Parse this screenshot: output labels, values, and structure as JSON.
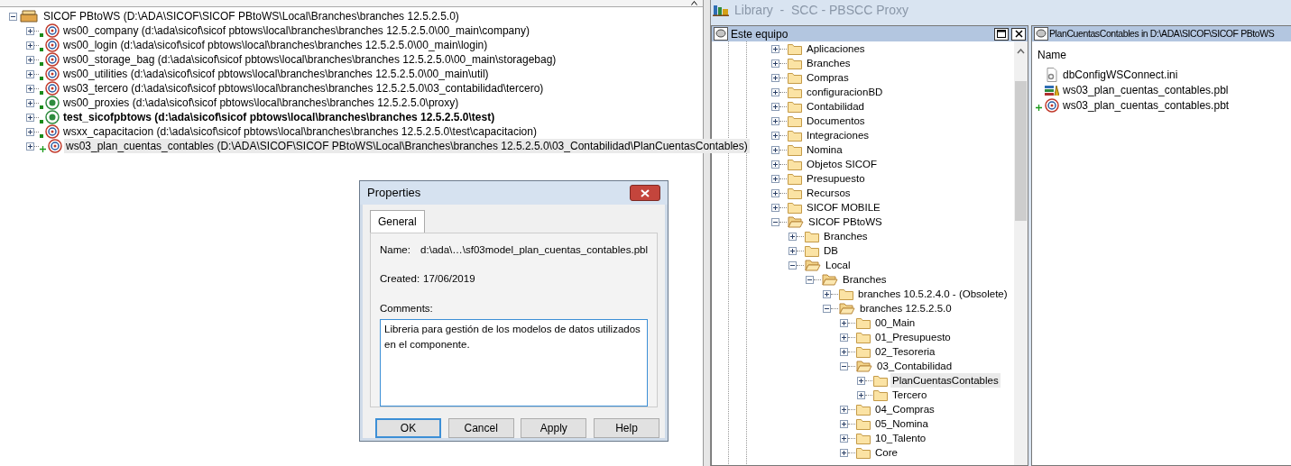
{
  "workspace_tree": {
    "root": {
      "label": "SICOF PBtoWS (D:\\ADA\\SICOF\\SICOF PBtoWS\\Local\\Branches\\branches 12.5.2.5.0)",
      "expanded": true
    },
    "targets": [
      {
        "label": "ws00_company (d:\\ada\\sicof\\sicof pbtows\\local\\branches\\branches 12.5.2.5.0\\00_main\\company)",
        "kind": "web",
        "current": false,
        "added": false,
        "selected": false,
        "expanded": false
      },
      {
        "label": "ws00_login (d:\\ada\\sicof\\sicof pbtows\\local\\branches\\branches 12.5.2.5.0\\00_main\\login)",
        "kind": "web",
        "current": false,
        "added": false,
        "selected": false,
        "expanded": false
      },
      {
        "label": "ws00_storage_bag (d:\\ada\\sicof\\sicof pbtows\\local\\branches\\branches 12.5.2.5.0\\00_main\\storagebag)",
        "kind": "web",
        "current": false,
        "added": false,
        "selected": false,
        "expanded": false
      },
      {
        "label": "ws00_utilities (d:\\ada\\sicof\\sicof pbtows\\local\\branches\\branches 12.5.2.5.0\\00_main\\util)",
        "kind": "web",
        "current": false,
        "added": false,
        "selected": false,
        "expanded": false
      },
      {
        "label": "ws03_tercero (d:\\ada\\sicof\\sicof pbtows\\local\\branches\\branches 12.5.2.5.0\\03_contabilidad\\tercero)",
        "kind": "web",
        "current": false,
        "added": false,
        "selected": false,
        "expanded": false
      },
      {
        "label": "ws00_proxies (d:\\ada\\sicof\\sicof pbtows\\local\\branches\\branches 12.5.2.5.0\\proxy)",
        "kind": "app",
        "current": false,
        "added": false,
        "selected": false,
        "expanded": false
      },
      {
        "label": "test_sicofpbtows (d:\\ada\\sicof\\sicof pbtows\\local\\branches\\branches 12.5.2.5.0\\test)",
        "kind": "app",
        "current": true,
        "added": false,
        "selected": false,
        "expanded": false
      },
      {
        "label": "wsxx_capacitacion (d:\\ada\\sicof\\sicof pbtows\\local\\branches\\branches 12.5.2.5.0\\test\\capacitacion)",
        "kind": "web",
        "current": false,
        "added": false,
        "selected": false,
        "expanded": false
      },
      {
        "label": "ws03_plan_cuentas_contables (D:\\ADA\\SICOF\\SICOF PBtoWS\\Local\\Branches\\branches 12.5.2.5.0\\03_Contabilidad\\PlanCuentasContables)",
        "kind": "web",
        "current": false,
        "added": true,
        "selected": true,
        "expanded": false
      }
    ]
  },
  "dialog": {
    "title": "Properties",
    "tabs": [
      {
        "label": "General",
        "selected": true
      }
    ],
    "fields": [
      {
        "label": "Name:",
        "value": "d:\\ada\\…\\sf03model_plan_cuentas_contables.pbl"
      },
      {
        "label": "Created:",
        "value": "17/06/2019"
      }
    ],
    "comments": {
      "label": "Comments:",
      "value": "Libreria para gestión de los modelos de datos utilizados en el componente."
    },
    "buttons": [
      {
        "label": "OK",
        "default": true
      },
      {
        "label": "Cancel",
        "default": false
      },
      {
        "label": "Apply",
        "default": false
      },
      {
        "label": "Help",
        "default": false
      }
    ]
  },
  "library": {
    "title": "Library  -  SCC - PBSCC Proxy",
    "folder_panel": {
      "title": "Este equipo",
      "tree": [
        {
          "label": "Aplicaciones",
          "expanded": false,
          "selected": false
        },
        {
          "label": "Branches",
          "expanded": false,
          "selected": false
        },
        {
          "label": "Compras",
          "expanded": false,
          "selected": false
        },
        {
          "label": "configuracionBD",
          "expanded": false,
          "selected": false
        },
        {
          "label": "Contabilidad",
          "expanded": false,
          "selected": false
        },
        {
          "label": "Documentos",
          "expanded": false,
          "selected": false
        },
        {
          "label": "Integraciones",
          "expanded": false,
          "selected": false
        },
        {
          "label": "Nomina",
          "expanded": false,
          "selected": false
        },
        {
          "label": "Objetos SICOF",
          "expanded": false,
          "selected": false
        },
        {
          "label": "Presupuesto",
          "expanded": false,
          "selected": false
        },
        {
          "label": "Recursos",
          "expanded": false,
          "selected": false
        },
        {
          "label": "SICOF MOBILE",
          "expanded": false,
          "selected": false
        },
        {
          "label": "SICOF PBtoWS",
          "expanded": true,
          "selected": false,
          "children": [
            {
              "label": "Branches",
              "expanded": false,
              "selected": false
            },
            {
              "label": "DB",
              "expanded": false,
              "selected": false
            },
            {
              "label": "Local",
              "expanded": true,
              "selected": false,
              "children": [
                {
                  "label": "Branches",
                  "expanded": true,
                  "selected": false,
                  "children": [
                    {
                      "label": "branches 10.5.2.4.0 - (Obsolete)",
                      "expanded": false,
                      "selected": false
                    },
                    {
                      "label": "branches 12.5.2.5.0",
                      "expanded": true,
                      "selected": false,
                      "children": [
                        {
                          "label": "00_Main",
                          "expanded": false,
                          "selected": false
                        },
                        {
                          "label": "01_Presupuesto",
                          "expanded": false,
                          "selected": false
                        },
                        {
                          "label": "02_Tesoreria",
                          "expanded": false,
                          "selected": false
                        },
                        {
                          "label": "03_Contabilidad",
                          "expanded": true,
                          "selected": false,
                          "children": [
                            {
                              "label": "PlanCuentasContables",
                              "expanded": false,
                              "selected": true
                            },
                            {
                              "label": "Tercero",
                              "expanded": false,
                              "selected": false
                            }
                          ]
                        },
                        {
                          "label": "04_Compras",
                          "expanded": false,
                          "selected": false
                        },
                        {
                          "label": "05_Nomina",
                          "expanded": false,
                          "selected": false
                        },
                        {
                          "label": "10_Talento",
                          "expanded": false,
                          "selected": false
                        },
                        {
                          "label": "Core",
                          "expanded": false,
                          "selected": false
                        }
                      ]
                    }
                  ]
                }
              ]
            }
          ]
        }
      ]
    },
    "list_panel": {
      "title": "PlanCuentasContables in D:\\ADA\\SICOF\\SICOF PBtoWS",
      "columns": [
        "Name"
      ],
      "files": [
        {
          "name": "dbConfigWSConnect.ini",
          "kind": "ini",
          "added": false
        },
        {
          "name": "ws03_plan_cuentas_contables.pbl",
          "kind": "pbl",
          "added": false
        },
        {
          "name": "ws03_plan_cuentas_contables.pbt",
          "kind": "pbt",
          "added": true
        }
      ]
    }
  }
}
